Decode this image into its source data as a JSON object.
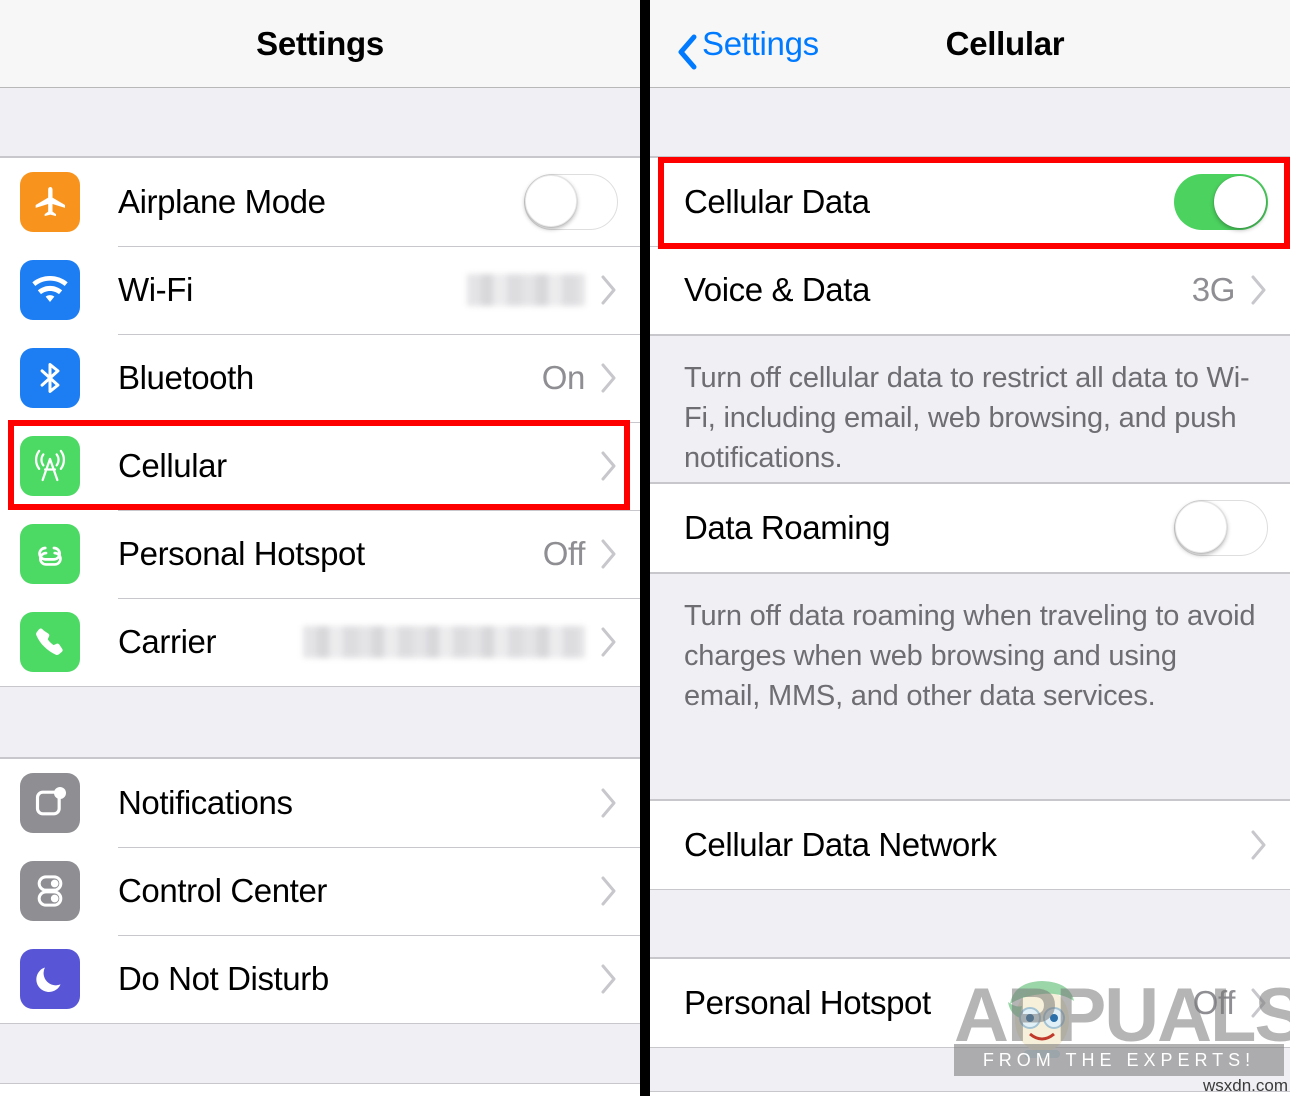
{
  "left_panel": {
    "navbar": {
      "title": "Settings"
    },
    "groups": [
      {
        "rows": [
          {
            "label": "Airplane Mode",
            "icon": "airplane-icon",
            "icon_color": "#f8941d",
            "control": "toggle",
            "toggle_state": "off"
          },
          {
            "label": "Wi-Fi",
            "icon": "wifi-icon",
            "icon_color": "#1d7ef3",
            "control": "chevron",
            "value": "",
            "redacted": "wifi"
          },
          {
            "label": "Bluetooth",
            "icon": "bluetooth-icon",
            "icon_color": "#1d7ef3",
            "control": "chevron",
            "value": "On"
          },
          {
            "label": "Cellular",
            "icon": "cellular-tower-icon",
            "icon_color": "#4cd964",
            "control": "chevron",
            "value": "",
            "highlighted": true
          },
          {
            "label": "Personal Hotspot",
            "icon": "hotspot-icon",
            "icon_color": "#4cd964",
            "control": "chevron",
            "value": "Off"
          },
          {
            "label": "Carrier",
            "icon": "phone-icon",
            "icon_color": "#4cd964",
            "control": "chevron",
            "value": "",
            "redacted": "carrier"
          }
        ]
      },
      {
        "rows": [
          {
            "label": "Notifications",
            "icon": "notifications-icon",
            "icon_color": "#8e8e93",
            "control": "chevron",
            "value": ""
          },
          {
            "label": "Control Center",
            "icon": "control-center-icon",
            "icon_color": "#8e8e93",
            "control": "chevron",
            "value": ""
          },
          {
            "label": "Do Not Disturb",
            "icon": "moon-icon",
            "icon_color": "#5856d6",
            "control": "chevron",
            "value": ""
          }
        ]
      }
    ]
  },
  "right_panel": {
    "navbar": {
      "back_label": "Settings",
      "title": "Cellular"
    },
    "rows": {
      "cellular_data": {
        "label": "Cellular Data",
        "control": "toggle",
        "toggle_state": "on",
        "highlighted": true
      },
      "voice_and_data": {
        "label": "Voice & Data",
        "value": "3G",
        "control": "chevron"
      },
      "data_roaming": {
        "label": "Data Roaming",
        "control": "toggle",
        "toggle_state": "off"
      },
      "cellular_data_network": {
        "label": "Cellular Data Network",
        "value": "",
        "control": "chevron"
      },
      "personal_hotspot": {
        "label": "Personal Hotspot",
        "value": "Off",
        "control": "chevron"
      }
    },
    "footnotes": {
      "cellular_data": "Turn off cellular data to restrict all data to Wi-Fi, including email, web browsing, and push notifications.",
      "data_roaming": "Turn off data roaming when traveling to avoid charges when web browsing and using email, MMS, and other data services."
    }
  },
  "watermark": {
    "brand": "APPUALS",
    "tagline": "FROM THE EXPERTS!",
    "url": "wsxdn.com"
  },
  "colors": {
    "accent_blue": "#007aff",
    "toggle_on_green": "#4cd25f",
    "highlight_red": "#ff0000",
    "group_background": "#efeff4",
    "separator": "#c8c7cc",
    "secondary_text": "#8e8e93"
  }
}
